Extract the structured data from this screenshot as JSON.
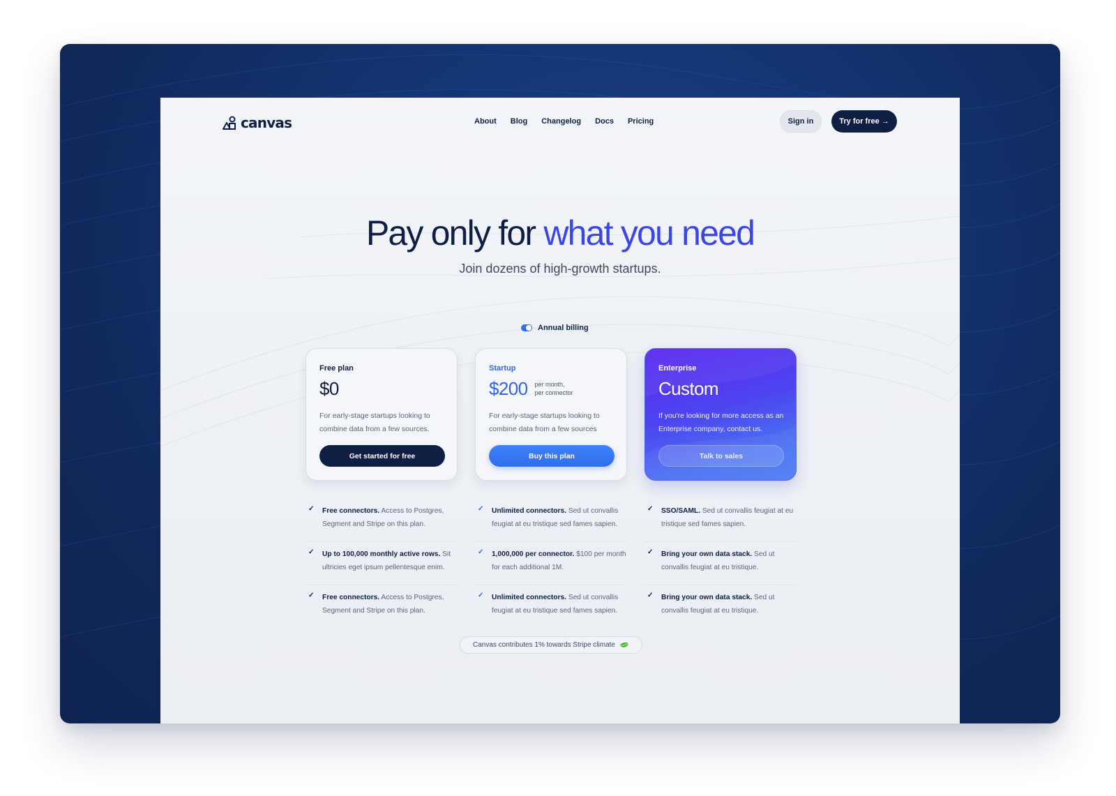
{
  "brand": {
    "name": "canvas",
    "logo_icon": "canvas-logo-icon"
  },
  "nav": {
    "links": [
      "About",
      "Blog",
      "Changelog",
      "Docs",
      "Pricing"
    ],
    "sign_in": "Sign in",
    "try_free": "Try for free",
    "try_free_icon": "→"
  },
  "hero": {
    "title_main": "Pay only for ",
    "title_accent": "what you need",
    "subtitle": "Join dozens of high-growth startups."
  },
  "billing": {
    "label": "Annual billing",
    "enabled": true
  },
  "plans": [
    {
      "name": "Free plan",
      "price": "$0",
      "price_note_1": "",
      "price_note_2": "",
      "description": "For early-stage startups looking to combine data from a few sources.",
      "cta": "Get started for free"
    },
    {
      "name": "Startup",
      "price": "$200",
      "price_note_1": "per month,",
      "price_note_2": "per connector",
      "description": "For early-stage startups looking to combine data from a few sources",
      "cta": "Buy this plan"
    },
    {
      "name": "Enterprise",
      "price": "Custom",
      "price_note_1": "",
      "price_note_2": "",
      "description": "If you're looking for more access as an Enterprise company, contact us.",
      "cta": "Talk to sales"
    }
  ],
  "features": [
    [
      {
        "title": "Free connectors.",
        "text": "Access to Postgres, Segment and Stripe on this plan."
      },
      {
        "title": "Up to 100,000 monthly active rows.",
        "text": "Sit ultricies eget ipsum pellentesque enim."
      },
      {
        "title": "Free connectors.",
        "text": "Access to Postgres, Segment and Stripe on this plan."
      }
    ],
    [
      {
        "title": "Unlimited connectors.",
        "text": "Sed ut convallis feugiat at eu tristique sed fames sapien."
      },
      {
        "title": "1,000,000 per connector.",
        "text": "$100 per month for each additional 1M."
      },
      {
        "title": "Unlimited connectors.",
        "text": "Sed ut convallis feugiat at eu tristique sed fames sapien."
      }
    ],
    [
      {
        "title": "SSO/SAML.",
        "text": "Sed ut convallis feugiat at eu tristique sed fames sapien."
      },
      {
        "title": "Bring your own data stack.",
        "text": "Sed ut convallis feugiat at eu tristique."
      },
      {
        "title": "Bring your own data stack.",
        "text": "Sed ut convallis feugiat at eu tristique."
      }
    ]
  ],
  "check_glyph": "✓",
  "climate": {
    "text": "Canvas contributes 1% towards Stripe climate",
    "icon": "leaf-icon"
  },
  "colors": {
    "navy": "#0f1f44",
    "accent": "#3b46e8",
    "blue": "#2f6df0",
    "enterprise_gradient_start": "#5b27f0",
    "enterprise_gradient_end": "#4b7ff4"
  }
}
